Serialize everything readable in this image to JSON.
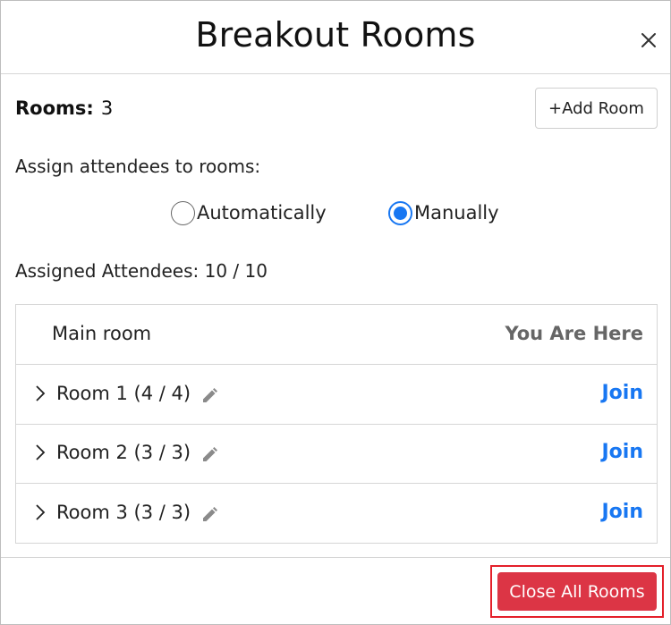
{
  "dialog": {
    "title": "Breakout Rooms"
  },
  "rooms_summary": {
    "label": "Rooms:",
    "count": "3",
    "add_room_label": "+Add Room"
  },
  "assign": {
    "label": "Assign attendees to rooms:",
    "options": [
      {
        "label": "Automatically",
        "checked": false
      },
      {
        "label": "Manually",
        "checked": true
      }
    ]
  },
  "assigned": {
    "text": "Assigned Attendees: 10 / 10"
  },
  "main_room": {
    "name": "Main room",
    "status": "You Are Here"
  },
  "rooms": [
    {
      "name": "Room 1 (4 / 4)",
      "action": "Join"
    },
    {
      "name": "Room 2 (3 / 3)",
      "action": "Join"
    },
    {
      "name": "Room 3 (3 / 3)",
      "action": "Join"
    }
  ],
  "footer": {
    "close_all_label": "Close All Rooms"
  },
  "colors": {
    "accent": "#1877f2",
    "danger": "#dc3545",
    "highlight_outline": "#e4202a"
  },
  "icons": {
    "close": "close-icon",
    "expand": "chevron-right-icon",
    "edit": "pencil-icon"
  }
}
